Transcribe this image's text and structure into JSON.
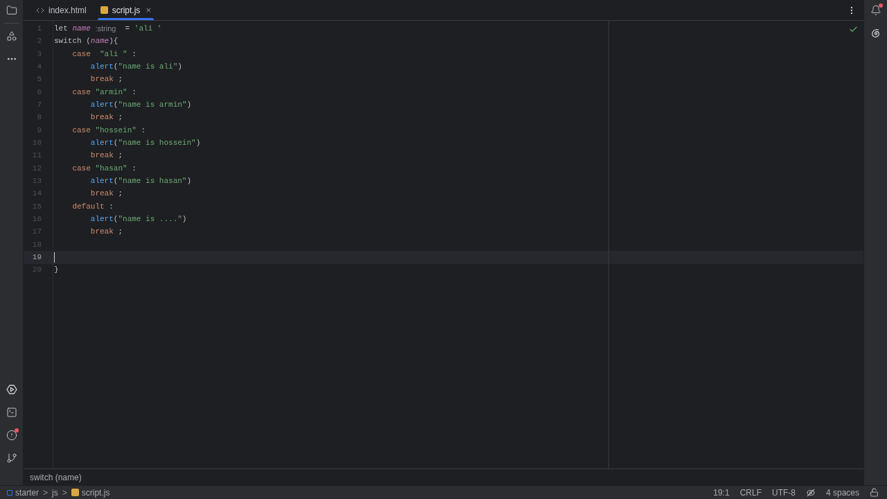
{
  "tabs": [
    {
      "label": "index.html",
      "kind": "html",
      "selected": false,
      "closable": false
    },
    {
      "label": "script.js",
      "kind": "js",
      "selected": true,
      "closable": true
    }
  ],
  "tab_close": "×",
  "editor": {
    "lines": [
      {
        "number": "1",
        "current": false,
        "tokens": [
          {
            "text": "let ",
            "kind": "plain"
          },
          {
            "text": "name ",
            "kind": "ident"
          },
          {
            "text": ":string",
            "kind": "hint"
          },
          {
            "text": "  = ",
            "kind": "plain"
          },
          {
            "text": "'ali '",
            "kind": "string"
          }
        ]
      },
      {
        "number": "2",
        "current": false,
        "tokens": [
          {
            "text": "switch (",
            "kind": "plain"
          },
          {
            "text": "name",
            "kind": "ident"
          },
          {
            "text": "){",
            "kind": "plain"
          }
        ]
      },
      {
        "number": "3",
        "current": false,
        "tokens": [
          {
            "text": "    case  ",
            "kind": "keyword"
          },
          {
            "text": "\"ali \"",
            "kind": "string"
          },
          {
            "text": " :",
            "kind": "plain"
          }
        ]
      },
      {
        "number": "4",
        "current": false,
        "tokens": [
          {
            "text": "        alert",
            "kind": "func"
          },
          {
            "text": "(",
            "kind": "plain"
          },
          {
            "text": "\"name is ali\"",
            "kind": "string"
          },
          {
            "text": ")",
            "kind": "plain"
          }
        ]
      },
      {
        "number": "5",
        "current": false,
        "tokens": [
          {
            "text": "        break",
            "kind": "keyword"
          },
          {
            "text": " ;",
            "kind": "plain"
          }
        ]
      },
      {
        "number": "6",
        "current": false,
        "tokens": [
          {
            "text": "    case ",
            "kind": "keyword"
          },
          {
            "text": "\"armin\"",
            "kind": "string"
          },
          {
            "text": " :",
            "kind": "plain"
          }
        ]
      },
      {
        "number": "7",
        "current": false,
        "tokens": [
          {
            "text": "        alert",
            "kind": "func"
          },
          {
            "text": "(",
            "kind": "plain"
          },
          {
            "text": "\"name is armin\"",
            "kind": "string"
          },
          {
            "text": ")",
            "kind": "plain"
          }
        ]
      },
      {
        "number": "8",
        "current": false,
        "tokens": [
          {
            "text": "        break",
            "kind": "keyword"
          },
          {
            "text": " ;",
            "kind": "plain"
          }
        ]
      },
      {
        "number": "9",
        "current": false,
        "tokens": [
          {
            "text": "    case ",
            "kind": "keyword"
          },
          {
            "text": "\"hossein\"",
            "kind": "string"
          },
          {
            "text": " :",
            "kind": "plain"
          }
        ]
      },
      {
        "number": "10",
        "current": false,
        "tokens": [
          {
            "text": "        alert",
            "kind": "func"
          },
          {
            "text": "(",
            "kind": "plain"
          },
          {
            "text": "\"name is hossein\"",
            "kind": "string"
          },
          {
            "text": ")",
            "kind": "plain"
          }
        ]
      },
      {
        "number": "11",
        "current": false,
        "tokens": [
          {
            "text": "        break",
            "kind": "keyword"
          },
          {
            "text": " ;",
            "kind": "plain"
          }
        ]
      },
      {
        "number": "12",
        "current": false,
        "tokens": [
          {
            "text": "    case ",
            "kind": "keyword"
          },
          {
            "text": "\"hasan\"",
            "kind": "string"
          },
          {
            "text": " :",
            "kind": "plain"
          }
        ]
      },
      {
        "number": "13",
        "current": false,
        "tokens": [
          {
            "text": "        alert",
            "kind": "func"
          },
          {
            "text": "(",
            "kind": "plain"
          },
          {
            "text": "\"name is hasan\"",
            "kind": "string"
          },
          {
            "text": ")",
            "kind": "plain"
          }
        ]
      },
      {
        "number": "14",
        "current": false,
        "tokens": [
          {
            "text": "        break",
            "kind": "keyword"
          },
          {
            "text": " ;",
            "kind": "plain"
          }
        ]
      },
      {
        "number": "15",
        "current": false,
        "tokens": [
          {
            "text": "    default",
            "kind": "keyword"
          },
          {
            "text": " :",
            "kind": "plain"
          }
        ]
      },
      {
        "number": "16",
        "current": false,
        "tokens": [
          {
            "text": "        alert",
            "kind": "func"
          },
          {
            "text": "(",
            "kind": "plain"
          },
          {
            "text": "\"name is ....\"",
            "kind": "string"
          },
          {
            "text": ")",
            "kind": "plain"
          }
        ]
      },
      {
        "number": "17",
        "current": false,
        "tokens": [
          {
            "text": "        break",
            "kind": "keyword"
          },
          {
            "text": " ;",
            "kind": "plain"
          }
        ]
      },
      {
        "number": "18",
        "current": false
      },
      {
        "number": "19",
        "current": true
      },
      {
        "number": "20",
        "current": false,
        "tokens": [
          {
            "text": "}",
            "kind": "plain"
          }
        ]
      }
    ]
  },
  "left_toolbar": {
    "top": [
      {
        "kind": "folder",
        "notification": false
      },
      {
        "kind": "structure",
        "notification": false
      },
      {
        "kind": "more",
        "notification": false
      }
    ],
    "bottom": [
      {
        "kind": "run",
        "notification": false
      },
      {
        "kind": "terminal",
        "notification": false
      },
      {
        "kind": "problems",
        "notification": true
      },
      {
        "kind": "git",
        "notification": false
      }
    ]
  },
  "right_toolbar": [
    {
      "kind": "bell",
      "notification": true
    },
    {
      "kind": "ai",
      "notification": false
    }
  ],
  "context_line": "switch (name)",
  "breadcrumbs": [
    {
      "label": "starter",
      "kind": "module"
    },
    {
      "label": "js",
      "kind": "folder"
    },
    {
      "label": "script.js",
      "kind": "js"
    }
  ],
  "breadcrumb_separator": ">",
  "status": {
    "position": "19:1",
    "line_ending": "CRLF",
    "encoding": "UTF-8",
    "indent": "4 spaces"
  }
}
